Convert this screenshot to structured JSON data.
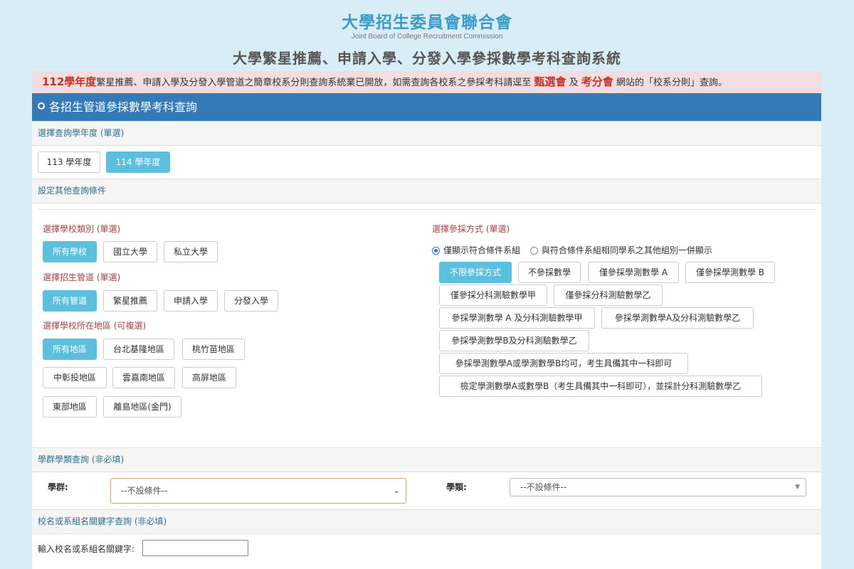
{
  "header": {
    "org_title": "大學招生委員會聯合會",
    "org_subtitle": "Joint Board of College Recruitment Commission",
    "system_title": "大學繁星推薦、申請入學、分發入學參採數學考科查詢系統"
  },
  "notice": {
    "year": "112學年度",
    "text_before": "繁星推薦、申請入學及分發入學管道之簡章校系分則查詢系統業已開放，如需查詢各校系之參採考科請逕至",
    "link1": "甄選會",
    "and": "及",
    "link2": "考分會",
    "text_after": "網站的「校系分則」查詢。"
  },
  "panel": {
    "title": "各招生管道參採數學考科查詢"
  },
  "year_section": {
    "title": "選擇查詢學年度 (單選)",
    "options": [
      "113 學年度",
      "114 學年度"
    ],
    "selected": "114 學年度"
  },
  "conditions": {
    "title": "設定其他查詢條件",
    "school_type": {
      "label": "選擇學校類別 (單選)",
      "options": [
        "所有學校",
        "國立大學",
        "私立大學"
      ]
    },
    "channel": {
      "label": "選擇招生管道 (單選)",
      "options": [
        "所有管道",
        "繁星推薦",
        "申請入學",
        "分發入學"
      ]
    },
    "region": {
      "label": "選擇學校所在地區 (可複選)",
      "options": [
        "所有地區",
        "台北基隆地區",
        "桃竹苗地區",
        "中彰投地區",
        "雲嘉南地區",
        "高屏地區",
        "東部地區",
        "離島地區(金門)"
      ]
    },
    "method": {
      "label": "選擇參採方式 (單選)",
      "radio1": "僅顯示符合條件系組",
      "radio2": "與符合條件系組相同學系之其他組別一併顯示",
      "options": [
        "不限參採方式",
        "不參採數學",
        "僅參採學測數學 A",
        "僅參採學測數學 B",
        "僅參採分科測驗數學甲",
        "僅參採分科測驗數學乙",
        "參採學測數學 A 及分科測驗數學甲",
        "參採學測數學A及分科測驗數學乙",
        "參採學測數學B及分科測驗數學乙",
        "參採學測數學A或學測數學B均可，考生具備其中一科即可",
        "檢定學測數學A或數學B（考生具備其中一科即可），並採計分科測驗數學乙"
      ]
    }
  },
  "group_section": {
    "title": "學群學類查詢 (非必填)",
    "group_label": "學群:",
    "group_value": "--不設條件--",
    "category_label": "學類:",
    "category_value": "--不設條件--"
  },
  "keyword_section": {
    "title": "校名或系組名關鍵字查詢 (非必填)",
    "label": "輸入校名或系組名關鍵字:",
    "value": ""
  },
  "colors": {
    "accent": "#337ab7",
    "active": "#5bc0de",
    "label_red": "#a94442",
    "notice_bg": "#f2dede"
  }
}
